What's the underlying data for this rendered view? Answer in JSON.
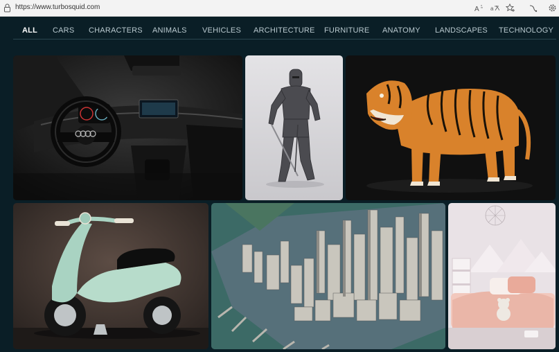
{
  "browser": {
    "url": "https://www.turbosquid.com",
    "icons": [
      "lock-icon",
      "read-aloud-icon",
      "translate-icon",
      "favorites-icon",
      "extension-icon",
      "settings-icon"
    ]
  },
  "nav": {
    "items": [
      "ALL",
      "CARS",
      "CHARACTERS",
      "ANIMALS",
      "VEHICLES",
      "ARCHITECTURE",
      "FURNITURE",
      "ANATOMY",
      "LANDSCAPES",
      "TECHNOLOGY"
    ],
    "active": "ALL"
  },
  "gallery": {
    "tiles": [
      "car-interior",
      "armored-knight",
      "tiger",
      "scooter",
      "city-aerial",
      "kids-bedroom"
    ]
  },
  "colors": {
    "page_bg": "#0a1e26",
    "nav_text": "#b9c9cf",
    "nav_active": "#ffffff"
  }
}
